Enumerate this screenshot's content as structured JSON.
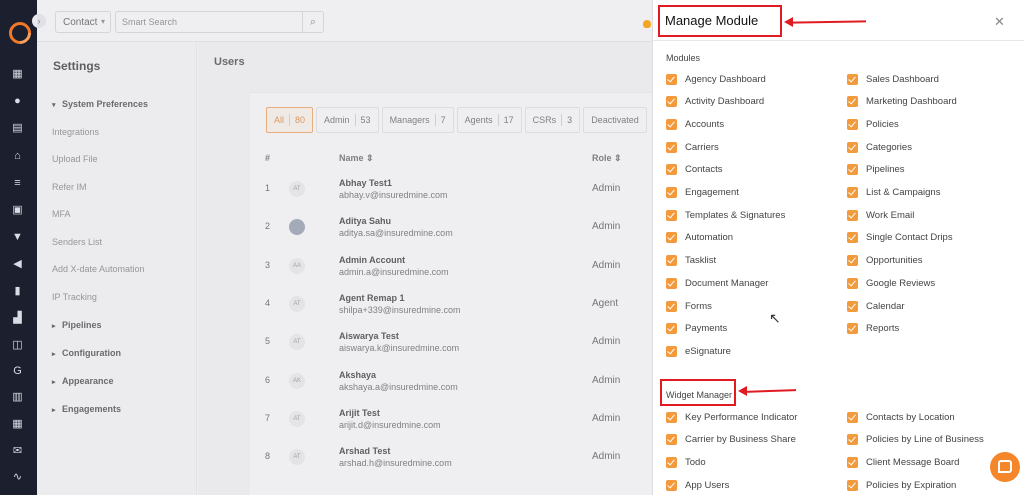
{
  "topbar": {
    "contact_select": "Contact",
    "search_placeholder": "Smart Search"
  },
  "settings": {
    "title": "Settings",
    "items": [
      {
        "label": "System Preferences",
        "kind": "group",
        "expanded": true
      },
      {
        "label": "Integrations",
        "kind": "sub"
      },
      {
        "label": "Upload File",
        "kind": "sub"
      },
      {
        "label": "Refer IM",
        "kind": "sub"
      },
      {
        "label": "MFA",
        "kind": "sub"
      },
      {
        "label": "Senders List",
        "kind": "sub"
      },
      {
        "label": "Add X-date Automation",
        "kind": "sub"
      },
      {
        "label": "IP Tracking",
        "kind": "sub"
      },
      {
        "label": "Pipelines",
        "kind": "group"
      },
      {
        "label": "Configuration",
        "kind": "group"
      },
      {
        "label": "Appearance",
        "kind": "group"
      },
      {
        "label": "Engagements",
        "kind": "group"
      }
    ]
  },
  "users": {
    "title": "Users",
    "filters": [
      {
        "label": "All",
        "count": "80",
        "active": true
      },
      {
        "label": "Admin",
        "count": "53"
      },
      {
        "label": "Managers",
        "count": "7"
      },
      {
        "label": "Agents",
        "count": "17"
      },
      {
        "label": "CSRs",
        "count": "3"
      },
      {
        "label": "Deactivated",
        "count": ""
      }
    ],
    "columns": {
      "num": "#",
      "name": "Name ⇕",
      "role": "Role ⇕"
    },
    "rows": [
      {
        "num": "1",
        "avatar": "AT",
        "name": "Abhay Test1",
        "email": "abhay.v@insuredmine.com",
        "role": "Admin"
      },
      {
        "num": "2",
        "avatar": "",
        "name": "Aditya Sahu",
        "email": "aditya.sa@insuredmine.com",
        "role": "Admin"
      },
      {
        "num": "3",
        "avatar": "AA",
        "name": "Admin Account",
        "email": "admin.a@insuredmine.com",
        "role": "Admin"
      },
      {
        "num": "4",
        "avatar": "AT",
        "name": "Agent Remap 1",
        "email": "shilpa+339@insuredmine.com",
        "role": "Agent"
      },
      {
        "num": "5",
        "avatar": "AT",
        "name": "Aiswarya Test",
        "email": "aiswarya.k@insuredmine.com",
        "role": "Admin"
      },
      {
        "num": "6",
        "avatar": "AK",
        "name": "Akshaya",
        "email": "akshaya.a@insuredmine.com",
        "role": "Admin"
      },
      {
        "num": "7",
        "avatar": "AT",
        "name": "Arijit Test",
        "email": "arijit.d@insuredmine.com",
        "role": "Admin"
      },
      {
        "num": "8",
        "avatar": "AT",
        "name": "Arshad Test",
        "email": "arshad.h@insuredmine.com",
        "role": "Admin"
      }
    ]
  },
  "modal": {
    "title": "Manage Module",
    "modules_label": "Modules",
    "modules_left": [
      "Agency Dashboard",
      "Activity Dashboard",
      "Accounts",
      "Carriers",
      "Contacts",
      "Engagement",
      "Templates & Signatures",
      "Automation",
      "Tasklist",
      "Document Manager",
      "Forms",
      "Payments",
      "eSignature"
    ],
    "modules_right": [
      "Sales Dashboard",
      "Marketing Dashboard",
      "Policies",
      "Categories",
      "Pipelines",
      "List & Campaigns",
      "Work Email",
      "Single Contact Drips",
      "Opportunities",
      "Google Reviews",
      "Calendar",
      "Reports"
    ],
    "widget_label": "Widget Manager",
    "widgets_left": [
      "Key Performance Indicator",
      "Carrier by Business Share",
      "Todo",
      "App Users"
    ],
    "widgets_right": [
      "Contacts by Location",
      "Policies by Line of Business",
      "Client Message Board",
      "Policies by Expiration"
    ]
  },
  "colors": {
    "accent": "#f29a3c",
    "annotation": "#e11b22",
    "rail": "#1b1f2e"
  }
}
